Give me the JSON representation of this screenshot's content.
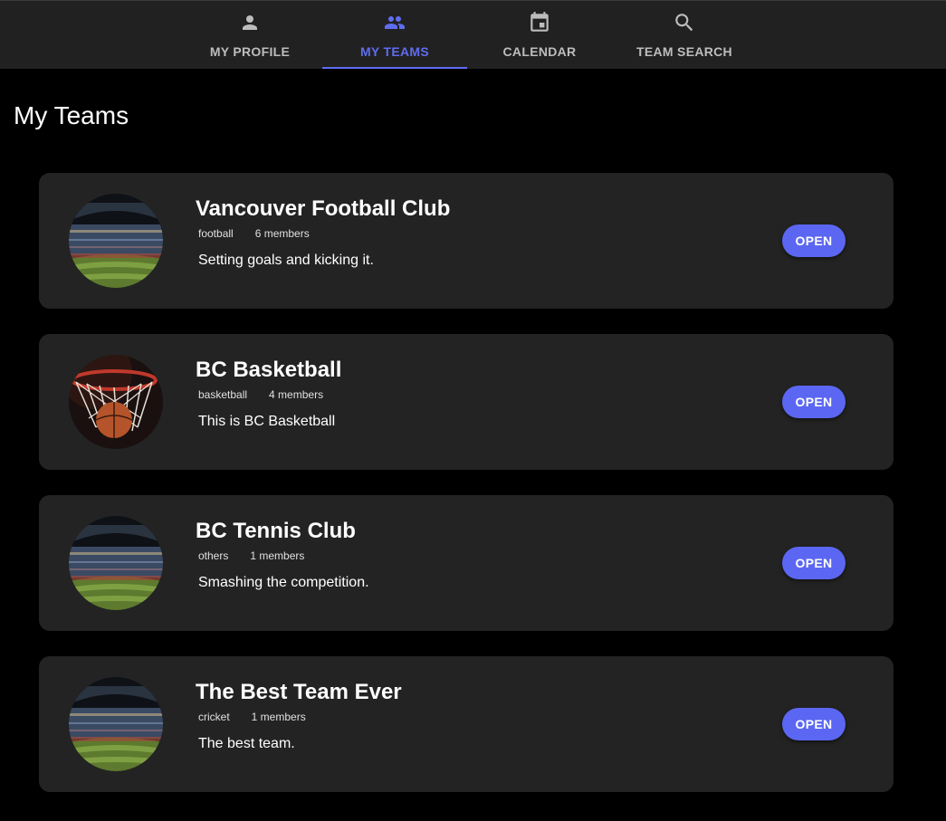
{
  "nav": {
    "tabs": [
      {
        "label": "MY PROFILE",
        "icon": "person-icon",
        "active": false
      },
      {
        "label": "MY TEAMS",
        "icon": "group-icon",
        "active": true
      },
      {
        "label": "CALENDAR",
        "icon": "calendar-icon",
        "active": false
      },
      {
        "label": "TEAM SEARCH",
        "icon": "search-icon",
        "active": false
      }
    ]
  },
  "page": {
    "title": "My Teams"
  },
  "teams": [
    {
      "name": "Vancouver Football Club",
      "sport": "football",
      "members": "6 members",
      "description": "Setting goals and kicking it.",
      "image": "stadium-image",
      "open_label": "OPEN"
    },
    {
      "name": "BC Basketball",
      "sport": "basketball",
      "members": "4 members",
      "description": "This is BC Basketball",
      "image": "basketball-hoop-image",
      "open_label": "OPEN"
    },
    {
      "name": "BC Tennis Club",
      "sport": "others",
      "members": "1 members",
      "description": "Smashing the competition.",
      "image": "stadium-image",
      "open_label": "OPEN"
    },
    {
      "name": "The Best Team Ever",
      "sport": "cricket",
      "members": "1 members",
      "description": "The best team.",
      "image": "stadium-image",
      "open_label": "OPEN"
    }
  ],
  "colors": {
    "accent": "#5f6cf0",
    "card_background": "#232323",
    "nav_background": "#212121",
    "page_background": "#000000"
  }
}
